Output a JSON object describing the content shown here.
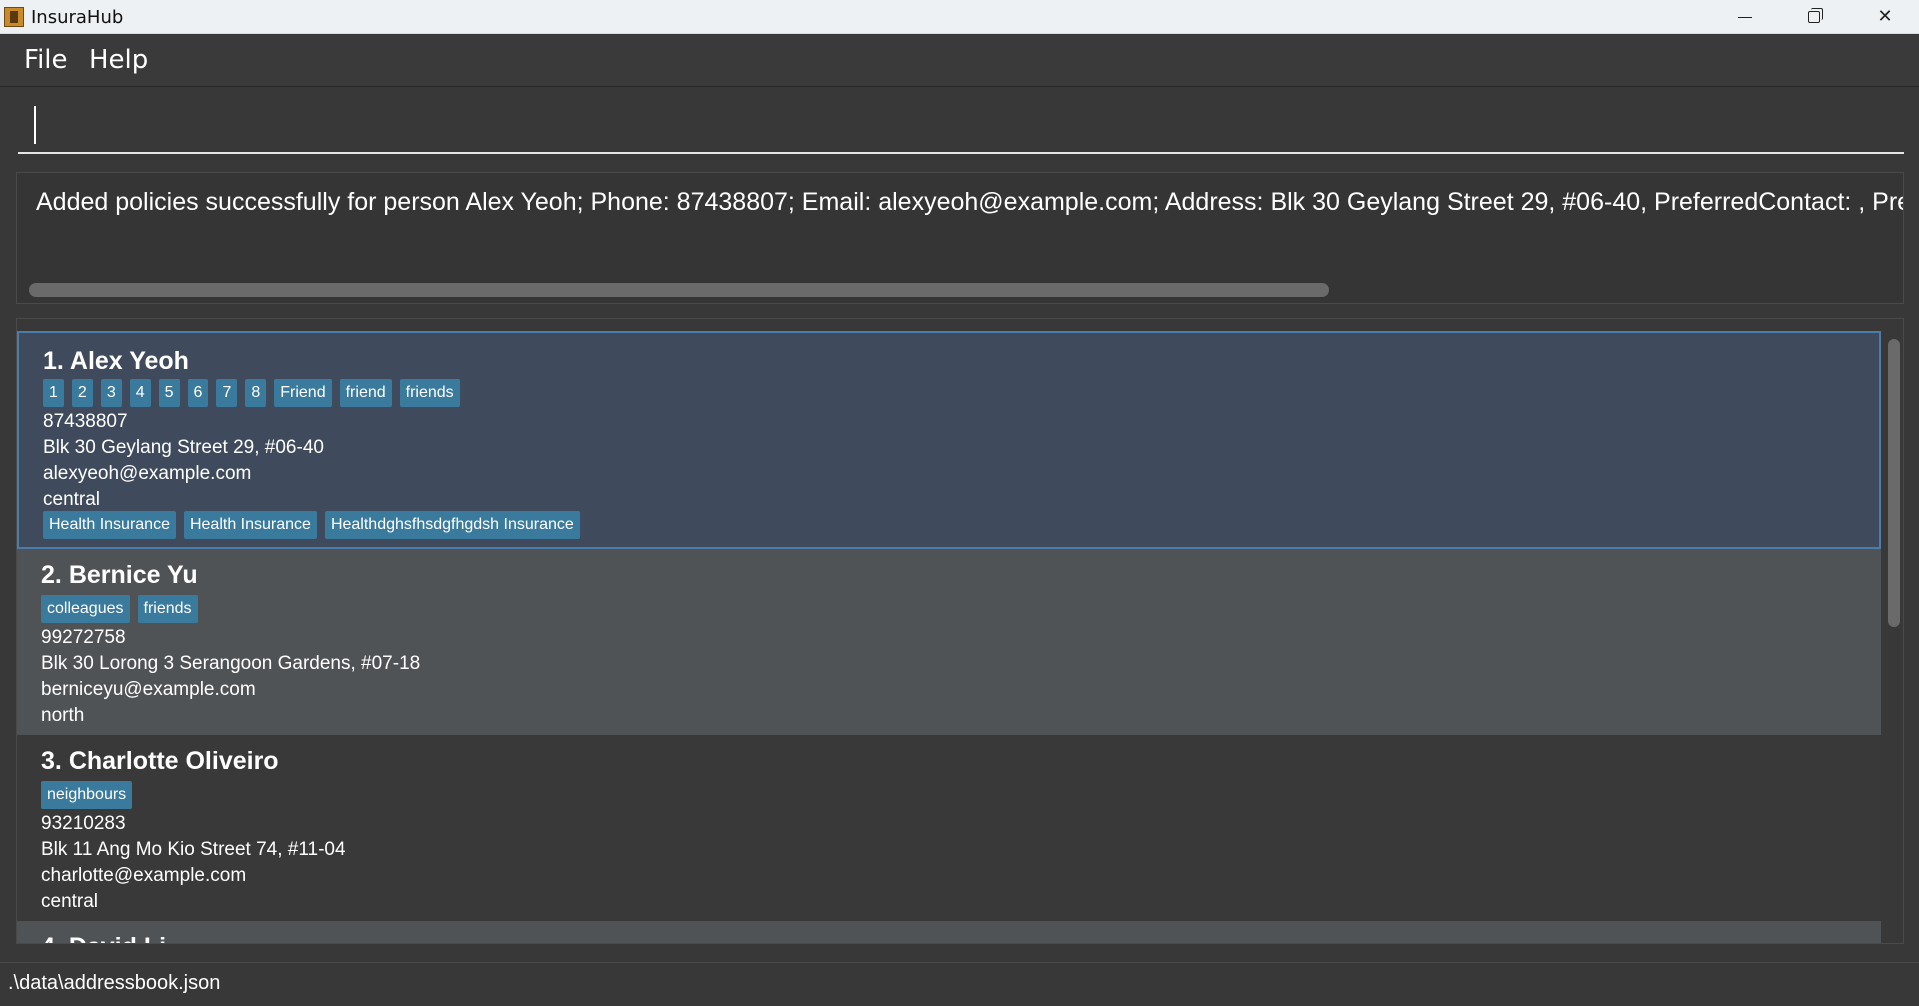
{
  "window": {
    "title": "InsuraHub"
  },
  "menu": {
    "file": "File",
    "help": "Help"
  },
  "command": {
    "value": ""
  },
  "result": {
    "text": "Added policies successfully for person Alex Yeoh; Phone: 87438807; Email: alexyeoh@example.com; Address: Blk 30 Geylang Street 29, #06-40, PreferredContact: , Preferred"
  },
  "persons": [
    {
      "index": "1.",
      "name": "Alex Yeoh",
      "tags": [
        "1",
        "2",
        "3",
        "4",
        "5",
        "6",
        "7",
        "8",
        "Friend",
        "friend",
        "friends"
      ],
      "phone": "87438807",
      "address": "Blk 30 Geylang Street 29, #06-40",
      "email": "alexyeoh@example.com",
      "region": "central",
      "policies": [
        "Health Insurance",
        "Health Insurance",
        "Healthdghsfhsdgfhgdsh Insurance"
      ]
    },
    {
      "index": "2.",
      "name": "Bernice Yu",
      "tags": [
        "colleagues",
        "friends"
      ],
      "phone": "99272758",
      "address": "Blk 30 Lorong 3 Serangoon Gardens, #07-18",
      "email": "berniceyu@example.com",
      "region": "north"
    },
    {
      "index": "3.",
      "name": "Charlotte Oliveiro",
      "tags": [
        "neighbours"
      ],
      "phone": "93210283",
      "address": "Blk 11 Ang Mo Kio Street 74, #11-04",
      "email": "charlotte@example.com",
      "region": "central"
    },
    {
      "index": "4.",
      "name": "David Li"
    }
  ],
  "status": {
    "path": ".\\data\\addressbook.json"
  }
}
